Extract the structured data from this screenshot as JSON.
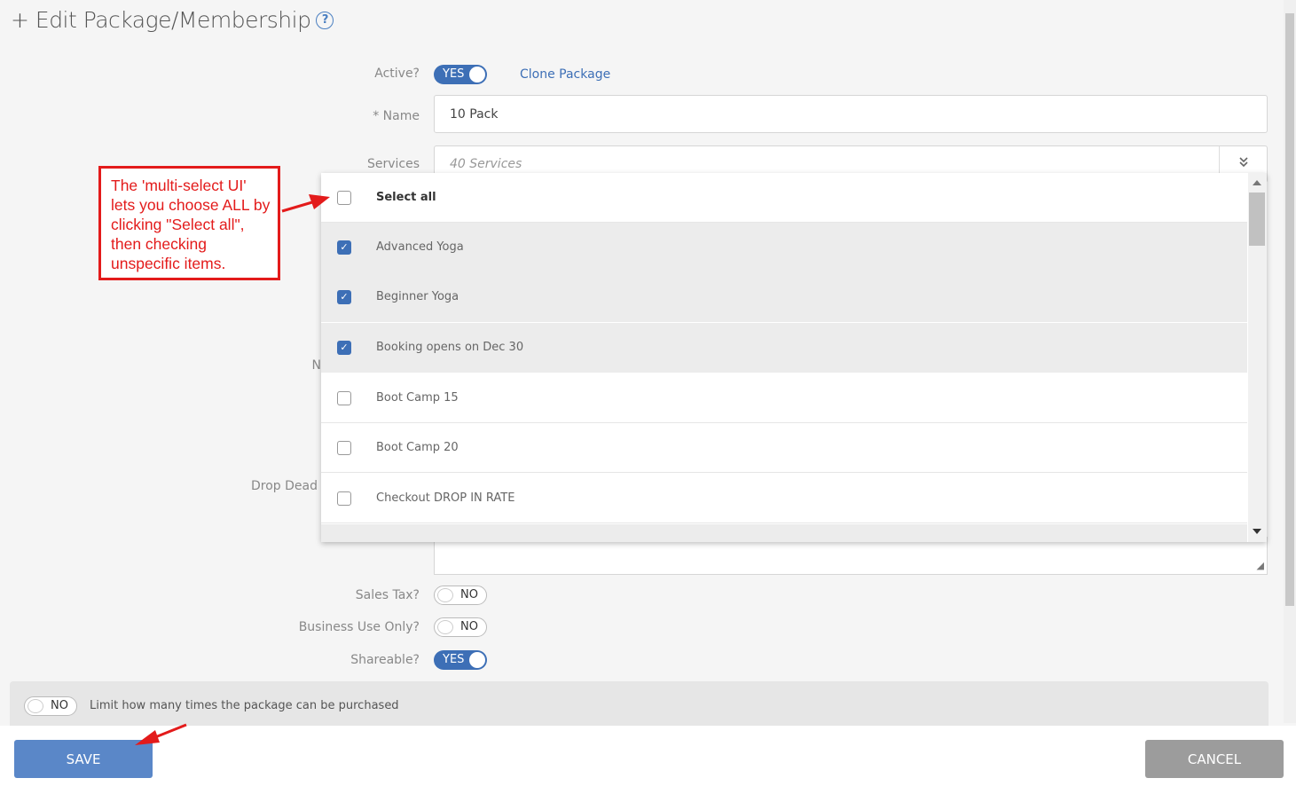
{
  "header": {
    "title": "+ Edit Package/Membership",
    "help_icon": "question-circle-icon"
  },
  "form": {
    "active_label": "Active?",
    "active_toggle": "YES",
    "clone_link": "Clone Package",
    "name_label": "* Name",
    "name_value": "10 Pack",
    "services_label": "Services",
    "services_value": "40 Services",
    "partial_label_n": "N",
    "drop_dead_label": "Drop Dead",
    "sales_tax_label": "Sales Tax?",
    "sales_tax_toggle": "NO",
    "business_label": "Business Use Only?",
    "business_toggle": "NO",
    "shareable_label": "Shareable?",
    "shareable_toggle": "YES"
  },
  "dropdown": {
    "select_all": "Select all",
    "items": [
      {
        "label": "Advanced Yoga",
        "checked": true
      },
      {
        "label": "Beginner Yoga",
        "checked": true
      },
      {
        "label": "Booking opens on Dec 30",
        "checked": true
      },
      {
        "label": "Boot Camp 15",
        "checked": false
      },
      {
        "label": "Boot Camp 20",
        "checked": false
      },
      {
        "label": "Checkout DROP IN RATE",
        "checked": false
      }
    ]
  },
  "limit": {
    "toggle": "NO",
    "text": "Limit how many times the package can be purchased"
  },
  "footer": {
    "save": "SAVE",
    "cancel": "CANCEL"
  },
  "annotation": {
    "callout_text": "The 'multi-select UI' lets you choose ALL by clicking \"Select all\", then checking unspecific items.",
    "arrow_color": "#e31b1b"
  },
  "colors": {
    "accent": "#3d6fb6",
    "save": "#5a87c8",
    "cancel": "#9c9c9c"
  }
}
